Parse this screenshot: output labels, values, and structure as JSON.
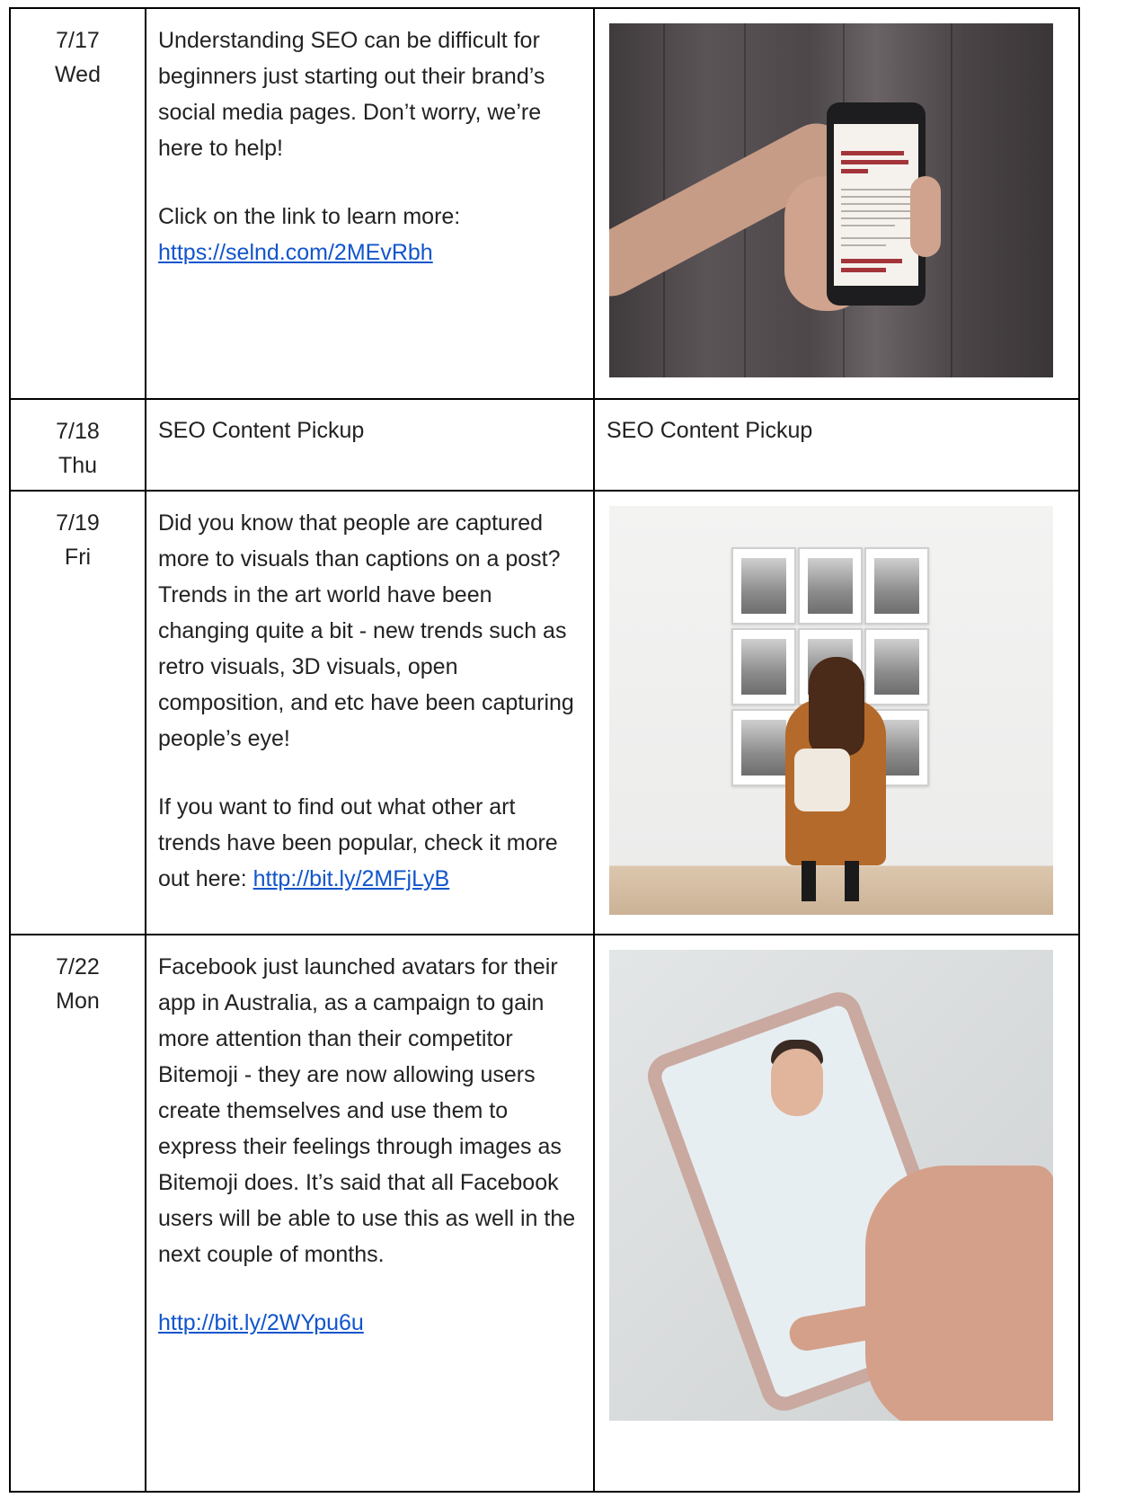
{
  "rows": [
    {
      "date": "7/17",
      "day": "Wed",
      "paragraph1": "Understanding SEO can be difficult for beginners just starting out their brand’s social media pages.  Don’t worry, we’re here to help!",
      "paragraph2": "Click on the link to learn more:",
      "link": "https://selnd.com/2MEvRbh"
    },
    {
      "date": "7/18",
      "day": "Thu",
      "caption": "SEO Content Pickup",
      "media": "SEO Content Pickup"
    },
    {
      "date": "7/19",
      "day": "Fri",
      "paragraph1": "Did you know that people are captured more to visuals than captions on a post? Trends in the art world have been changing quite a bit - new trends such as retro visuals, 3D visuals, open composition, and etc have been capturing people’s eye!",
      "paragraph2": "If you want to find out what other art trends have been popular, check it more out here: ",
      "link": "http://bit.ly/2MFjLyB"
    },
    {
      "date": "7/22",
      "day": "Mon",
      "paragraph1": "Facebook just launched avatars for their app in Australia, as a campaign to gain more attention than their competitor Bitemoji - they are now allowing users create themselves and use them to express their feelings through images as Bitemoji does. It’s said that all Facebook users will be able to use this as well in the next couple of months.",
      "link": "http://bit.ly/2WYpu6u"
    }
  ],
  "colors": {
    "link": "#1155cc",
    "border": "#000000"
  }
}
